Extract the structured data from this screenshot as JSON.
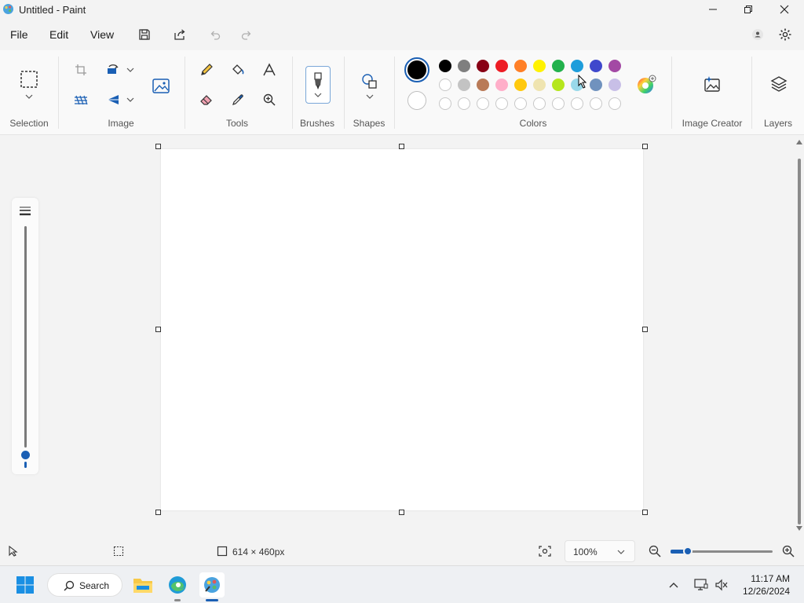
{
  "window": {
    "title": "Untitled - Paint"
  },
  "menu": {
    "file": "File",
    "edit": "Edit",
    "view": "View"
  },
  "ribbon": {
    "selection_label": "Selection",
    "image_label": "Image",
    "tools_label": "Tools",
    "brushes_label": "Brushes",
    "shapes_label": "Shapes",
    "colors_label": "Colors",
    "image_creator_label": "Image Creator",
    "layers_label": "Layers"
  },
  "colors": {
    "primary": "#000000",
    "secondary": "#ffffff",
    "row1": [
      "#000000",
      "#7f7f7f",
      "#880015",
      "#ed1c24",
      "#ff7f27",
      "#fff200",
      "#22b14c",
      "#1e9ddb",
      "#3f48cc",
      "#a349a4"
    ],
    "row2": [
      "#ffffff",
      "#c3c3c3",
      "#b97a57",
      "#ffaec9",
      "#ffc90e",
      "#efe4b0",
      "#b5e61d",
      "#99d9ea",
      "#7092be",
      "#c8bfe7"
    ],
    "row3_count": 10
  },
  "status": {
    "canvas_size": "614 × 460px",
    "zoom": "100%"
  },
  "taskbar": {
    "search_label": "Search",
    "time": "11:17 AM",
    "date": "12/26/2024"
  }
}
